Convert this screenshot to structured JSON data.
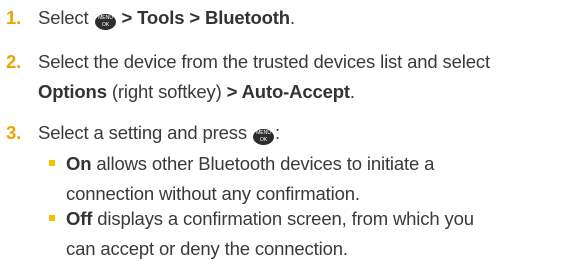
{
  "steps": [
    {
      "number": "1.",
      "lines": [
        {
          "pre": "Select ",
          "key": "menu-ok-key",
          "post_bold": " > Tools > Bluetooth",
          "post": "."
        }
      ]
    },
    {
      "number": "2.",
      "line1": "Select the device from the trusted devices list and select",
      "line2_bold_a": "Options",
      "line2_mid": " (right softkey) ",
      "line2_bold_b": "> Auto-Accept",
      "line2_end": "."
    },
    {
      "number": "3.",
      "line1_pre": "Select a setting and press ",
      "line1_post": ":"
    }
  ],
  "menu_key": {
    "top": "MENU",
    "bottom": "OK"
  },
  "bullets": [
    {
      "bold": "On",
      "line1": " allows other Bluetooth devices to initiate a",
      "line2": "connection without any confirmation."
    },
    {
      "bold": "Off",
      "line1": " displays a confirmation screen, from which you",
      "line2": "can accept or deny the connection."
    }
  ],
  "colors": {
    "step_number": "#f0a200",
    "bullet": "#f2c200",
    "text": "#3a3a3a"
  }
}
